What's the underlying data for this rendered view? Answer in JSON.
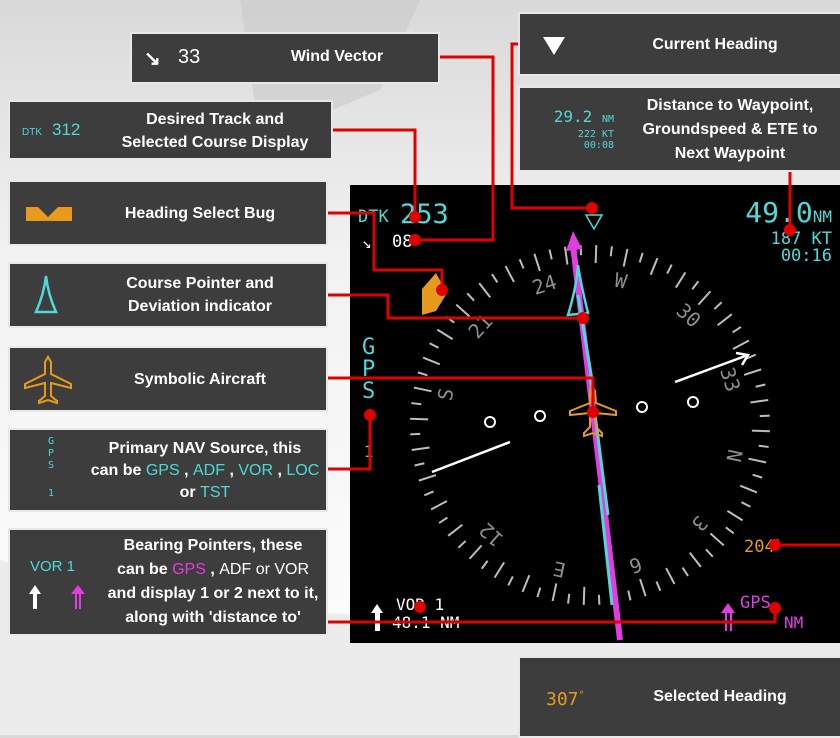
{
  "callouts": {
    "wind": {
      "arrow": "↘",
      "value": "33",
      "label": "Wind Vector"
    },
    "dtk": {
      "prefix": "DTK",
      "value": "312",
      "label_line1": "Desired Track and",
      "label_line2": "Selected Course Display"
    },
    "heading_bug": {
      "label": "Heading Select Bug"
    },
    "course_pointer": {
      "label_line1": "Course Pointer and",
      "label_line2": "Deviation indicator"
    },
    "aircraft": {
      "label": "Symbolic Aircraft"
    },
    "nav_source": {
      "sample": [
        "G",
        "P",
        "S",
        "1"
      ],
      "line1": "Primary NAV Source, this",
      "line2_prefix": "can be",
      "sources": [
        "GPS",
        "ADF",
        "VOR",
        "LOC"
      ],
      "line3_prefix": "or",
      "last_source": "TST"
    },
    "bearing": {
      "sample_label": "VOR 1",
      "line1": "Bearing Pointers, these",
      "line2_prefix": "can be",
      "gps": "GPS",
      "adf": "ADF",
      "vor": "or VOR",
      "line3": "and display 1 or 2 next to it,",
      "line4": "along with 'distance to'"
    },
    "current_heading": {
      "label": "Current Heading"
    },
    "distance": {
      "sample_dist": "29.2",
      "sample_unit": "NM",
      "sample_gs": "222 KT",
      "sample_ete": "00:08",
      "line1": "Distance to Waypoint,",
      "line2": "Groundspeed & ETE to",
      "line3": "Next Waypoint"
    },
    "selected_heading": {
      "value": "307",
      "label": "Selected Heading"
    }
  },
  "display": {
    "dtk_prefix": "DTK",
    "dtk_value": "253",
    "wind_arrow": "↘",
    "wind_value": "08",
    "distance": "49.0",
    "distance_unit": "NM",
    "groundspeed": "187 KT",
    "ete": "00:16",
    "nav_source": [
      "G",
      "P",
      "S",
      "1"
    ],
    "compass_labels": [
      "24",
      "W",
      "30",
      "33",
      "N",
      "3",
      "6",
      "E",
      "12",
      "S",
      "21"
    ],
    "selected_heading_value": "204",
    "bearing_source": "VOR 1",
    "bearing_distance": "48.1 NM",
    "gps_label": "GPS",
    "gps_unit": "NM"
  },
  "colors": {
    "cyan": "#4fd8d8",
    "magenta": "#e23ce2",
    "orange": "#e89a1c",
    "leader": "#e00000",
    "box": "#3d3d3d"
  }
}
